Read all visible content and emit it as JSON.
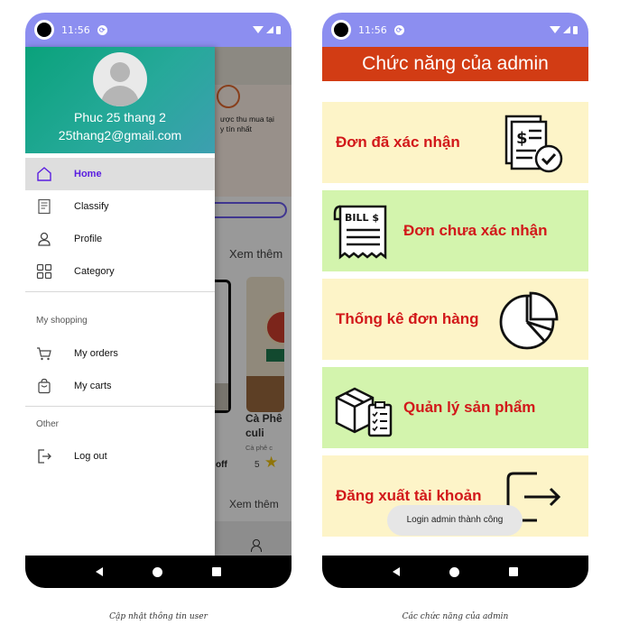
{
  "left_phone": {
    "status": {
      "time": "11:56"
    },
    "drawer": {
      "user_name": "Phuc 25 thang 2",
      "user_email": "25thang2@gmail.com",
      "items": [
        {
          "label": "Home",
          "icon": "home-icon",
          "active": true
        },
        {
          "label": "Classify",
          "icon": "receipt-icon"
        },
        {
          "label": "Profile",
          "icon": "person-icon"
        },
        {
          "label": "Category",
          "icon": "grid-icon"
        }
      ],
      "section_shopping": "My shopping",
      "shopping_items": [
        {
          "label": "My orders",
          "icon": "cart-icon"
        },
        {
          "label": "My carts",
          "icon": "shopping-bag-icon"
        }
      ],
      "section_other": "Other",
      "other_items": [
        {
          "label": "Log out",
          "icon": "logout-icon"
        }
      ]
    },
    "background": {
      "banner_text": "ược thu mua tại\ny tín nhất",
      "more_1": "Xem thêm",
      "discount": "off",
      "product_name": "Cà Phê\nculi",
      "product_sub": "Cà phê c",
      "rating": "5",
      "more_2": "Xem thêm"
    }
  },
  "right_phone": {
    "status": {
      "time": "11:56"
    },
    "title": "Chức năng của admin",
    "items": [
      {
        "label": "Đơn đã xác nhận",
        "icon": "confirmed-orders-icon",
        "color": "#fdf4c8"
      },
      {
        "label": "Đơn chưa xác nhận",
        "icon": "bill-icon",
        "color": "#d3f4ad"
      },
      {
        "label": "Thống kê đơn hàng",
        "icon": "pie-chart-icon",
        "color": "#fdf4c8"
      },
      {
        "label": "Quản lý sản phẩm",
        "icon": "box-checklist-icon",
        "color": "#d3f4ad"
      },
      {
        "label": "Đăng xuất tài khoản",
        "icon": "logout-icon",
        "color": "#fdf4c8"
      }
    ],
    "toast": "Login admin thành công"
  },
  "captions": {
    "left": "Cập nhật thông tin user",
    "right": "Các chức năng của admin"
  },
  "colors": {
    "status_bar": "#8c8ef0",
    "admin_title_bg": "#d23c14",
    "admin_text": "#d2181a",
    "drawer_active_text": "#5a1ee0"
  }
}
